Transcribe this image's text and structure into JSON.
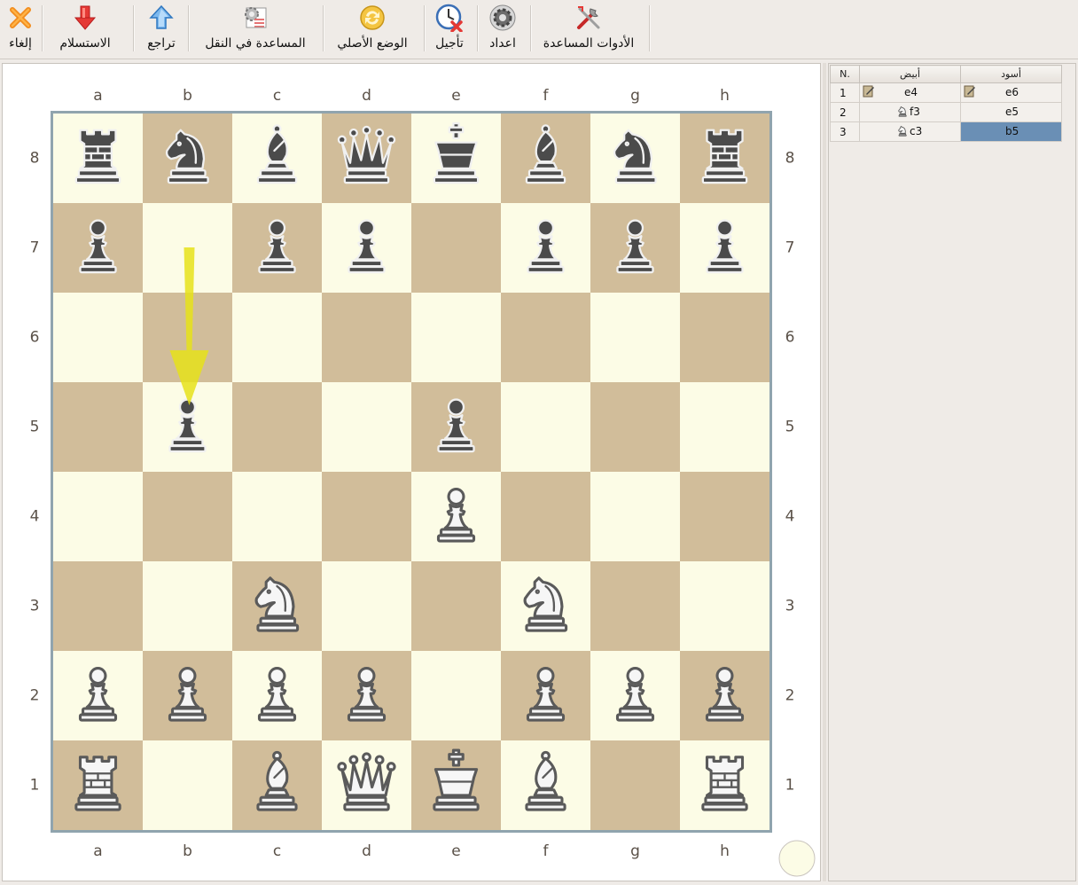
{
  "toolbar": {
    "items": [
      {
        "label": "إلغاء",
        "icon": "cancel-x-icon"
      },
      {
        "label": "الاستسلام",
        "icon": "resign-arrow-down-icon"
      },
      {
        "label": "تراجع",
        "icon": "undo-arrow-up-icon"
      },
      {
        "label": "المساعدة في النقل",
        "icon": "move-help-gears-icon"
      },
      {
        "label": "الوضع الأصلي",
        "icon": "reset-position-icon"
      },
      {
        "label": "تأجيل",
        "icon": "adjourn-clock-icon"
      },
      {
        "label": "اعداد",
        "icon": "settings-gear-icon"
      },
      {
        "label": "الأدوات المساعدة",
        "icon": "tools-icon"
      }
    ]
  },
  "board": {
    "files": [
      "a",
      "b",
      "c",
      "d",
      "e",
      "f",
      "g",
      "h"
    ],
    "ranks": [
      "8",
      "7",
      "6",
      "5",
      "4",
      "3",
      "2",
      "1"
    ],
    "light_color": "#fcfce6",
    "dark_color": "#d1bd9a",
    "border_color": "#90a4ae",
    "pieces": [
      {
        "square": "a8",
        "type": "rook",
        "color": "black"
      },
      {
        "square": "b8",
        "type": "knight",
        "color": "black"
      },
      {
        "square": "c8",
        "type": "bishop",
        "color": "black"
      },
      {
        "square": "d8",
        "type": "queen",
        "color": "black"
      },
      {
        "square": "e8",
        "type": "king",
        "color": "black"
      },
      {
        "square": "f8",
        "type": "bishop",
        "color": "black"
      },
      {
        "square": "g8",
        "type": "knight",
        "color": "black"
      },
      {
        "square": "h8",
        "type": "rook",
        "color": "black"
      },
      {
        "square": "a7",
        "type": "pawn",
        "color": "black"
      },
      {
        "square": "c7",
        "type": "pawn",
        "color": "black"
      },
      {
        "square": "d7",
        "type": "pawn",
        "color": "black"
      },
      {
        "square": "f7",
        "type": "pawn",
        "color": "black"
      },
      {
        "square": "g7",
        "type": "pawn",
        "color": "black"
      },
      {
        "square": "h7",
        "type": "pawn",
        "color": "black"
      },
      {
        "square": "b5",
        "type": "pawn",
        "color": "black"
      },
      {
        "square": "e5",
        "type": "pawn",
        "color": "black"
      },
      {
        "square": "e4",
        "type": "pawn",
        "color": "white"
      },
      {
        "square": "c3",
        "type": "knight",
        "color": "white"
      },
      {
        "square": "f3",
        "type": "knight",
        "color": "white"
      },
      {
        "square": "a2",
        "type": "pawn",
        "color": "white"
      },
      {
        "square": "b2",
        "type": "pawn",
        "color": "white"
      },
      {
        "square": "c2",
        "type": "pawn",
        "color": "white"
      },
      {
        "square": "d2",
        "type": "pawn",
        "color": "white"
      },
      {
        "square": "f2",
        "type": "pawn",
        "color": "white"
      },
      {
        "square": "g2",
        "type": "pawn",
        "color": "white"
      },
      {
        "square": "h2",
        "type": "pawn",
        "color": "white"
      },
      {
        "square": "a1",
        "type": "rook",
        "color": "white"
      },
      {
        "square": "c1",
        "type": "bishop",
        "color": "white"
      },
      {
        "square": "d1",
        "type": "queen",
        "color": "white"
      },
      {
        "square": "e1",
        "type": "king",
        "color": "white"
      },
      {
        "square": "f1",
        "type": "bishop",
        "color": "white"
      },
      {
        "square": "h1",
        "type": "rook",
        "color": "white"
      }
    ],
    "last_move_arrow": {
      "from": "b7",
      "to": "b5",
      "color": "#e6e21a"
    },
    "side_to_move": "white",
    "turn_indicator_color": "#fcfce6"
  },
  "notation": {
    "headers": [
      "N.",
      "أبيض",
      "أسود"
    ],
    "rows": [
      {
        "n": "1",
        "white": "e4",
        "white_icon": "note-icon",
        "black": "e6",
        "black_icon": "note-icon"
      },
      {
        "n": "2",
        "white": "f3",
        "white_icon": "knight-icon",
        "black": "e5",
        "black_icon": ""
      },
      {
        "n": "3",
        "white": "c3",
        "white_icon": "knight-icon",
        "black": "b5",
        "black_icon": ""
      }
    ],
    "selected": {
      "row": 3,
      "col": "black"
    },
    "selected_color": "#6a8fb5"
  }
}
